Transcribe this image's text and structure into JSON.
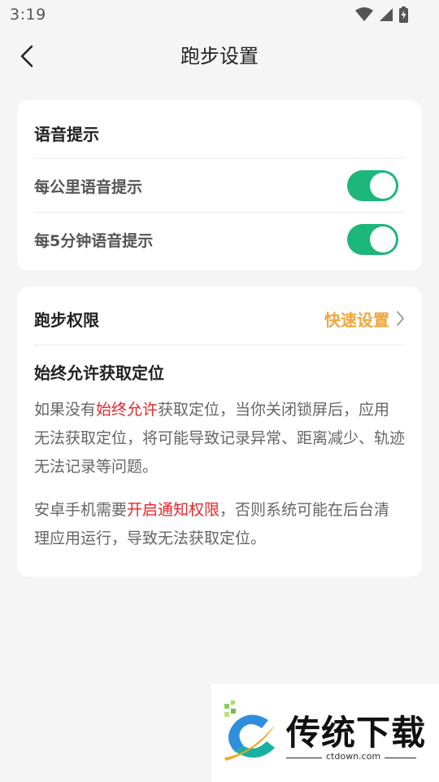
{
  "status_bar": {
    "time": "3:19"
  },
  "header": {
    "title": "跑步设置"
  },
  "voice_card": {
    "title": "语音提示",
    "items": [
      {
        "label": "每公里语音提示",
        "enabled": true
      },
      {
        "label": "每5分钟语音提示",
        "enabled": true
      }
    ]
  },
  "permission_card": {
    "title": "跑步权限",
    "quick_setup": "快速设置",
    "subtitle": "始终允许获取定位",
    "para1": {
      "before": "如果没有",
      "highlight": "始终允许",
      "after": "获取定位，当你关闭锁屏后，应用无法获取定位，将可能导致记录异常、距离减少、轨迹无法记录等问题。"
    },
    "para2": {
      "before": "安卓手机需要",
      "highlight": "开启通知权限",
      "after": "，否则系统可能在后台清理应用运行，导致无法获取定位。"
    }
  },
  "watermark": {
    "text": "传统下载",
    "url": "ctdown.com"
  },
  "colors": {
    "accent_green": "#1db67b",
    "accent_orange": "#f0a63a",
    "highlight_red": "#e8262a"
  }
}
